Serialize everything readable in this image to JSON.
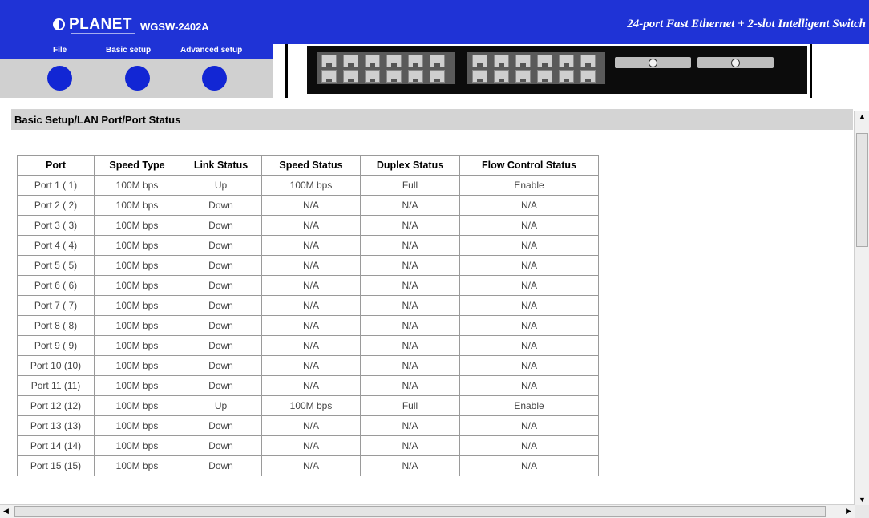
{
  "header": {
    "logo": "PLANET",
    "model": "WGSW-2402A",
    "tagline": "24-port Fast Ethernet + 2-slot Intelligent Switch"
  },
  "menu": [
    {
      "label": "File"
    },
    {
      "label": "Basic setup"
    },
    {
      "label": "Advanced setup"
    }
  ],
  "breadcrumb": "Basic Setup/LAN Port/Port Status",
  "table": {
    "headers": [
      "Port",
      "Speed Type",
      "Link Status",
      "Speed Status",
      "Duplex Status",
      "Flow Control Status"
    ],
    "rows": [
      [
        "Port 1 ( 1)",
        "100M bps",
        "Up",
        "100M bps",
        "Full",
        "Enable"
      ],
      [
        "Port 2 ( 2)",
        "100M bps",
        "Down",
        "N/A",
        "N/A",
        "N/A"
      ],
      [
        "Port 3 ( 3)",
        "100M bps",
        "Down",
        "N/A",
        "N/A",
        "N/A"
      ],
      [
        "Port 4 ( 4)",
        "100M bps",
        "Down",
        "N/A",
        "N/A",
        "N/A"
      ],
      [
        "Port 5 ( 5)",
        "100M bps",
        "Down",
        "N/A",
        "N/A",
        "N/A"
      ],
      [
        "Port 6 ( 6)",
        "100M bps",
        "Down",
        "N/A",
        "N/A",
        "N/A"
      ],
      [
        "Port 7 ( 7)",
        "100M bps",
        "Down",
        "N/A",
        "N/A",
        "N/A"
      ],
      [
        "Port 8 ( 8)",
        "100M bps",
        "Down",
        "N/A",
        "N/A",
        "N/A"
      ],
      [
        "Port 9 ( 9)",
        "100M bps",
        "Down",
        "N/A",
        "N/A",
        "N/A"
      ],
      [
        "Port 10 (10)",
        "100M bps",
        "Down",
        "N/A",
        "N/A",
        "N/A"
      ],
      [
        "Port 11 (11)",
        "100M bps",
        "Down",
        "N/A",
        "N/A",
        "N/A"
      ],
      [
        "Port 12 (12)",
        "100M bps",
        "Up",
        "100M bps",
        "Full",
        "Enable"
      ],
      [
        "Port 13 (13)",
        "100M bps",
        "Down",
        "N/A",
        "N/A",
        "N/A"
      ],
      [
        "Port 14 (14)",
        "100M bps",
        "Down",
        "N/A",
        "N/A",
        "N/A"
      ],
      [
        "Port 15 (15)",
        "100M bps",
        "Down",
        "N/A",
        "N/A",
        "N/A"
      ]
    ]
  },
  "icons": {
    "menu_dot": "circle-icon",
    "scroll_up": "arrow-up-icon",
    "scroll_down": "arrow-down-icon",
    "scroll_left": "arrow-left-icon",
    "scroll_right": "arrow-right-icon"
  },
  "colors": {
    "brand_blue": "#1f33d6",
    "menu_dot": "#1226d4"
  }
}
